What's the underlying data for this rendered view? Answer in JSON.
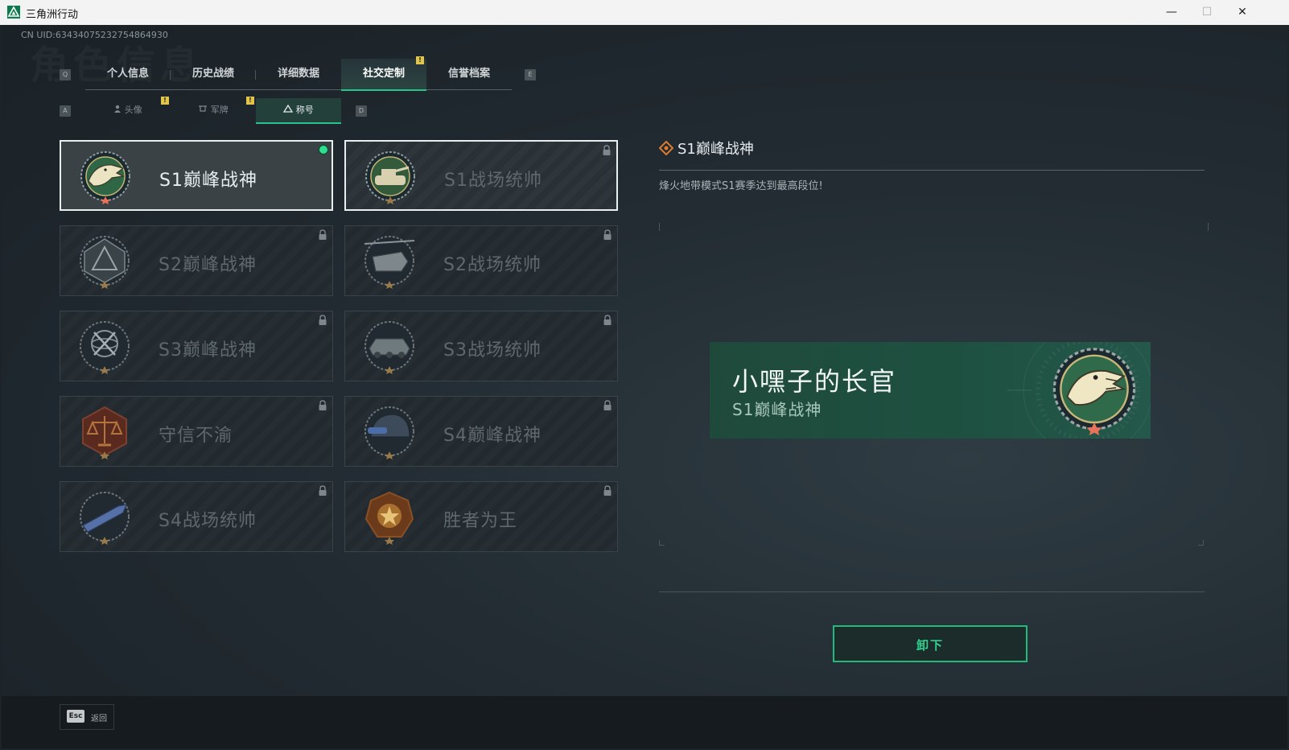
{
  "window": {
    "title": "三角洲行动",
    "minimize": "—",
    "maximize": "☐",
    "close": "✕"
  },
  "uid": "CN UID:63434075232754864930",
  "background_title": "角色信息",
  "keys": {
    "prev_tab": "Q",
    "next_tab": "E",
    "prev_sub": "A",
    "next_sub": "D"
  },
  "tabs": [
    {
      "label": "个人信息"
    },
    {
      "label": "历史战绩"
    },
    {
      "label": "详细数据"
    },
    {
      "label": "社交定制",
      "active": true,
      "notice": "!"
    },
    {
      "label": "信誉档案"
    }
  ],
  "subtabs": [
    {
      "label": "头像",
      "icon": "person-icon",
      "notice": "!"
    },
    {
      "label": "军牌",
      "icon": "dogtag-icon",
      "notice": "!"
    },
    {
      "label": "称号",
      "icon": "title-icon",
      "active": true
    }
  ],
  "titles": [
    {
      "name": "S1巅峰战神",
      "badge": "crocodile-badge",
      "state": "equipped"
    },
    {
      "name": "S1战场统帅",
      "badge": "tank-badge",
      "state": "locked"
    },
    {
      "name": "S2巅峰战神",
      "badge": "triangle-badge",
      "state": "locked"
    },
    {
      "name": "S2战场统帅",
      "badge": "helicopter-badge",
      "state": "locked"
    },
    {
      "name": "S3巅峰战神",
      "badge": "globe-badge",
      "state": "locked"
    },
    {
      "name": "S3战场统帅",
      "badge": "apc-badge",
      "state": "locked"
    },
    {
      "name": "守信不渝",
      "badge": "scales-badge",
      "state": "locked"
    },
    {
      "name": "S4巅峰战神",
      "badge": "helmet-badge",
      "state": "locked"
    },
    {
      "name": "S4战场统帅",
      "badge": "missile-badge",
      "state": "locked"
    },
    {
      "name": "胜者为王",
      "badge": "medal-badge",
      "state": "locked"
    }
  ],
  "detail": {
    "title": "S1巅峰战神",
    "description": "烽火地带模式S1赛季达到最高段位!",
    "banner_player": "小嘿子的长官",
    "banner_title": "S1巅峰战神",
    "action": "卸下"
  },
  "footer": {
    "esc_key": "Esc",
    "back_label": "返回"
  },
  "colors": {
    "accent": "#27c38a",
    "notice": "#e1c54a",
    "banner": "#1e5141"
  }
}
